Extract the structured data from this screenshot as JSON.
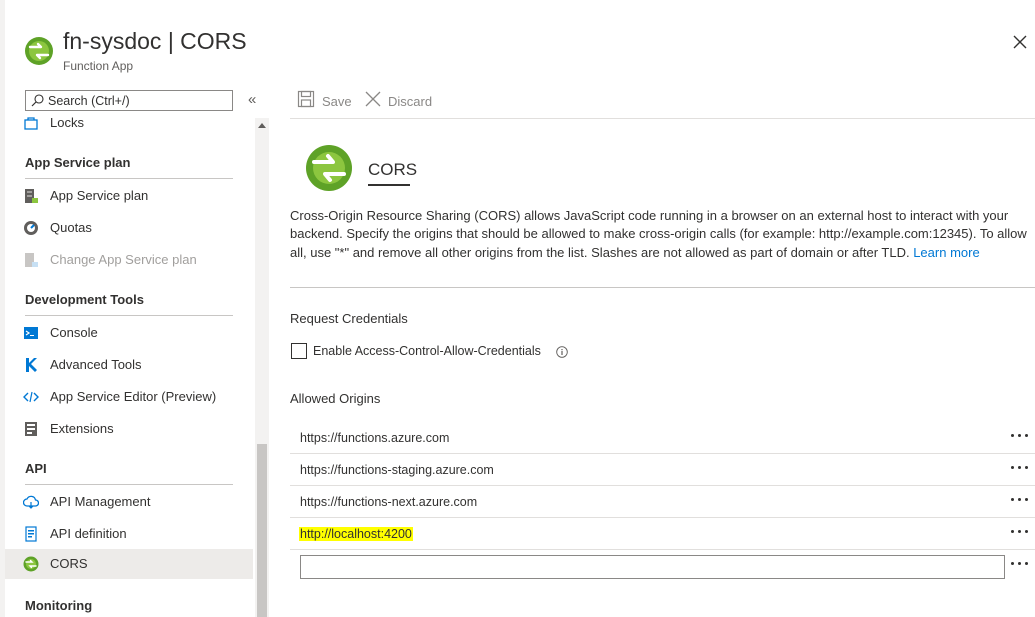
{
  "header": {
    "title": "fn-sysdoc | CORS",
    "subtitle": "Function App"
  },
  "search": {
    "placeholder": "Search (Ctrl+/)"
  },
  "nav": {
    "items_top": [
      {
        "label": "Locks",
        "icon": "lock-icon"
      }
    ],
    "groups": [
      {
        "title": "App Service plan",
        "items": [
          {
            "label": "App Service plan",
            "icon": "app-service-plan-icon"
          },
          {
            "label": "Quotas",
            "icon": "quotas-icon"
          },
          {
            "label": "Change App Service plan",
            "icon": "change-plan-icon",
            "disabled": true
          }
        ]
      },
      {
        "title": "Development Tools",
        "items": [
          {
            "label": "Console",
            "icon": "console-icon"
          },
          {
            "label": "Advanced Tools",
            "icon": "advanced-tools-icon"
          },
          {
            "label": "App Service Editor (Preview)",
            "icon": "code-editor-icon"
          },
          {
            "label": "Extensions",
            "icon": "extensions-icon"
          }
        ]
      },
      {
        "title": "API",
        "items": [
          {
            "label": "API Management",
            "icon": "api-management-icon"
          },
          {
            "label": "API definition",
            "icon": "api-definition-icon"
          },
          {
            "label": "CORS",
            "icon": "cors-icon",
            "active": true
          }
        ]
      },
      {
        "title": "Monitoring",
        "items": []
      }
    ]
  },
  "toolbar": {
    "save_label": "Save",
    "discard_label": "Discard"
  },
  "blade": {
    "title": "CORS",
    "description": "Cross-Origin Resource Sharing (CORS) allows JavaScript code running in a browser on an external host to interact with your backend. Specify the origins that should be allowed to make cross-origin calls (for example: http://example.com:12345). To allow all, use \"*\" and remove all other origins from the list. Slashes are not allowed as part of domain or after TLD.",
    "learn_more": "Learn more"
  },
  "request_credentials": {
    "heading": "Request Credentials",
    "checkbox_label": "Enable Access-Control-Allow-Credentials",
    "checked": false
  },
  "allowed_origins": {
    "heading": "Allowed Origins",
    "origins": [
      "https://functions.azure.com",
      "https://functions-staging.azure.com",
      "https://functions-next.azure.com",
      "http://localhost:4200"
    ],
    "new_origin_value": ""
  },
  "colors": {
    "accent": "#0078d4",
    "highlight": "#ffff00",
    "active_nav_bg": "#edebe9"
  }
}
